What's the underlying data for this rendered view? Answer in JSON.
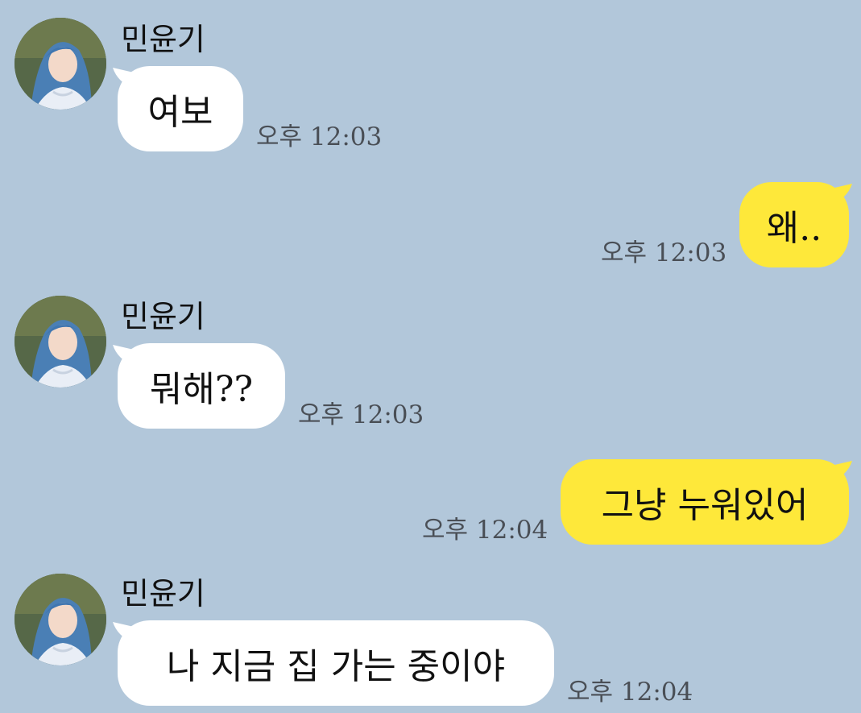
{
  "chat": {
    "contact_name": "민윤기",
    "avatar_icon": "profile-photo-avatar",
    "colors": {
      "background": "#b2c7da",
      "incoming_bubble": "#ffffff",
      "outgoing_bubble": "#fee83a"
    },
    "messages": [
      {
        "direction": "incoming",
        "sender": "민윤기",
        "text": "여보",
        "time": "오후 12:03"
      },
      {
        "direction": "outgoing",
        "text": "왜..",
        "time": "오후 12:03"
      },
      {
        "direction": "incoming",
        "sender": "민윤기",
        "text": "뭐해??",
        "time": "오후 12:03"
      },
      {
        "direction": "outgoing",
        "text": "그냥 누워있어",
        "time": "오후 12:04"
      },
      {
        "direction": "incoming",
        "sender": "민윤기",
        "text": "나 지금 집 가는 중이야",
        "time": "오후 12:04"
      }
    ]
  }
}
